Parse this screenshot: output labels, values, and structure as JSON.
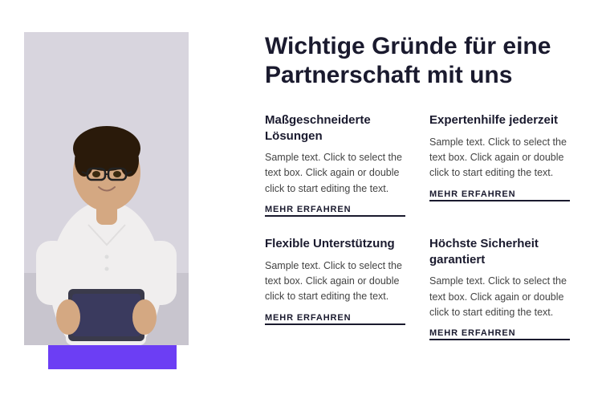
{
  "header": {
    "title_line1": "Wichtige Gründe für eine",
    "title_line2": "Partnerschaft mit uns"
  },
  "features": [
    {
      "id": "massgeschneiderte",
      "title": "Maßgeschneiderte Lösungen",
      "text": "Sample text. Click to select the text box. Click again or double click to start editing the text.",
      "link": "MEHR ERFAHREN"
    },
    {
      "id": "expertenhilfe",
      "title": "Expertenhilfe jederzeit",
      "text": "Sample text. Click to select the text box. Click again or double click to start editing the text.",
      "link": "MEHR ERFAHREN"
    },
    {
      "id": "flexible",
      "title": "Flexible Unterstützung",
      "text": "Sample text. Click to select the text box. Click again or double click to start editing the text.",
      "link": "MEHR ERFAHREN"
    },
    {
      "id": "sicherheit",
      "title": "Höchste Sicherheit garantiert",
      "text": "Sample text. Click to select the text box. Click again or double click to start editing the text.",
      "link": "MEHR ERFAHREN"
    }
  ],
  "colors": {
    "purple": "#6c3ef4",
    "dark": "#1a1a2e"
  }
}
